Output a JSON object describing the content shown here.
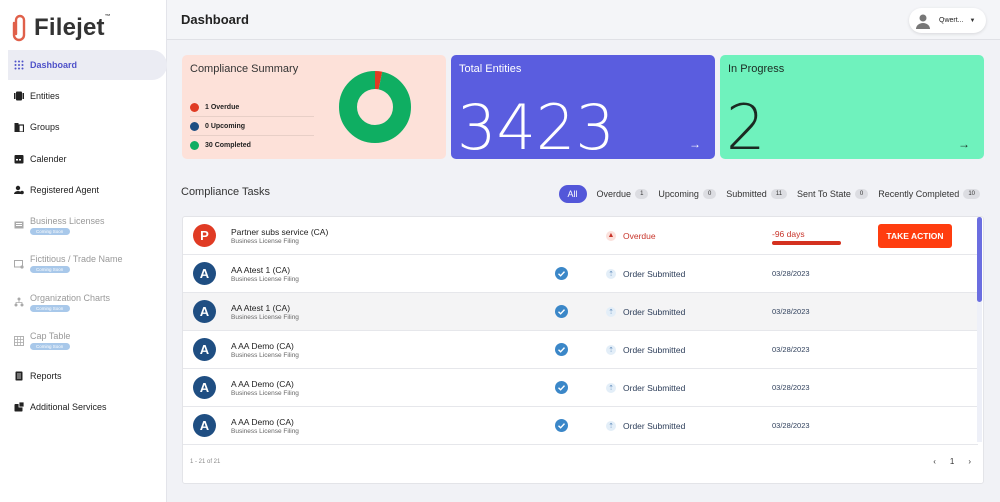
{
  "app": {
    "name": "Filejet",
    "tm": "™"
  },
  "sidebar": {
    "items": [
      {
        "label": "Dashboard",
        "icon": "grid-icon",
        "active": true
      },
      {
        "label": "Entities",
        "icon": "entities-icon"
      },
      {
        "label": "Groups",
        "icon": "groups-icon"
      },
      {
        "label": "Calender",
        "icon": "calendar-icon"
      },
      {
        "label": "Registered Agent",
        "icon": "agent-icon"
      },
      {
        "label": "Business Licenses",
        "icon": "license-icon",
        "badge": "Coming Soon"
      },
      {
        "label": "Fictitious / Trade Name",
        "icon": "trade-name-icon",
        "badge": "Coming Soon"
      },
      {
        "label": "Organization Charts",
        "icon": "org-chart-icon",
        "badge": "Coming Soon"
      },
      {
        "label": "Cap Table",
        "icon": "table-icon",
        "badge": "Coming Soon"
      },
      {
        "label": "Reports",
        "icon": "reports-icon"
      },
      {
        "label": "Additional Services",
        "icon": "services-icon"
      }
    ]
  },
  "header": {
    "title": "Dashboard",
    "user": "Qwert..."
  },
  "summary": {
    "title": "Compliance Summary",
    "legend": [
      {
        "label": "1 Overdue",
        "color": "#e03b24"
      },
      {
        "label": "0 Upcoming",
        "color": "#1f4e82"
      },
      {
        "label": "30 Completed",
        "color": "#0fae62"
      }
    ],
    "chart_values": {
      "overdue": 1,
      "upcoming": 0,
      "completed": 30
    }
  },
  "total": {
    "title": "Total Entities",
    "value": "3423",
    "arrow": "→"
  },
  "progress": {
    "title": "In Progress",
    "value": "2",
    "arrow": "→"
  },
  "tasks": {
    "title": "Compliance Tasks",
    "tabs": [
      {
        "label": "All",
        "active": true
      },
      {
        "label": "Overdue",
        "count": "1"
      },
      {
        "label": "Upcoming",
        "count": "0"
      },
      {
        "label": "Submitted",
        "count": "11"
      },
      {
        "label": "Sent To State",
        "count": "0"
      },
      {
        "label": "Recently Completed",
        "count": "10"
      }
    ],
    "rows": [
      {
        "initial": "P",
        "name": "Partner subs service (CA)",
        "sub": "Business License Filing",
        "status": "Overdue",
        "days": "-96 days",
        "action": "TAKE ACTION"
      },
      {
        "initial": "A",
        "name": "AA Atest 1 (CA)",
        "sub": "Business License Filing",
        "status": "Order Submitted",
        "date": "03/28/2023"
      },
      {
        "initial": "A",
        "name": "AA Atest 1 (CA)",
        "sub": "Business License Filing",
        "status": "Order Submitted",
        "date": "03/28/2023"
      },
      {
        "initial": "A",
        "name": "A AA Demo (CA)",
        "sub": "Business License Filing",
        "status": "Order Submitted",
        "date": "03/28/2023"
      },
      {
        "initial": "A",
        "name": "A AA Demo (CA)",
        "sub": "Business License Filing",
        "status": "Order Submitted",
        "date": "03/28/2023"
      },
      {
        "initial": "A",
        "name": "A AA Demo (CA)",
        "sub": "Business License Filing",
        "status": "Order Submitted",
        "date": "03/28/2023"
      }
    ],
    "pager_info": "1 - 21 of 21",
    "page": "1",
    "prev": "‹",
    "next": "›"
  },
  "colors": {
    "accent": "#5a5ddf",
    "overdue": "#e03b24",
    "navy": "#1f4e82",
    "green": "#0fae62"
  }
}
